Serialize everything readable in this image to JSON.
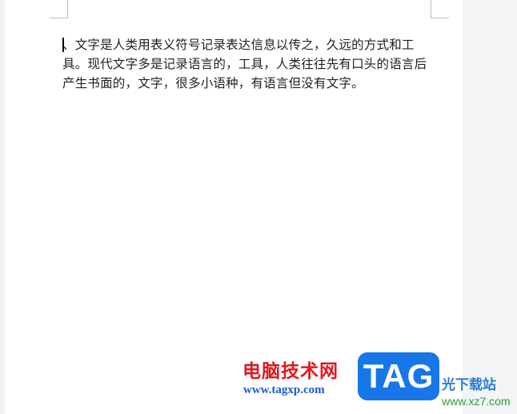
{
  "document": {
    "body_text": "、文字是人类用表义符号记录表达信息以传之，久远的方式和工具。现代文字多是记录语言的，工具，人类往往先有口头的语言后产生书面的，文字，很多小语种，有语言但没有文字。"
  },
  "watermark": {
    "cn_title": "电脑技术网",
    "url": "www.tagxp.com",
    "logo_text": "TAG",
    "site_name": "光下载站",
    "site_url": "www.xz7.com"
  },
  "colors": {
    "page": "#ffffff",
    "background": "#eef0f2",
    "watermark_red": "#e4161d",
    "watermark_blue": "#1877e8"
  }
}
